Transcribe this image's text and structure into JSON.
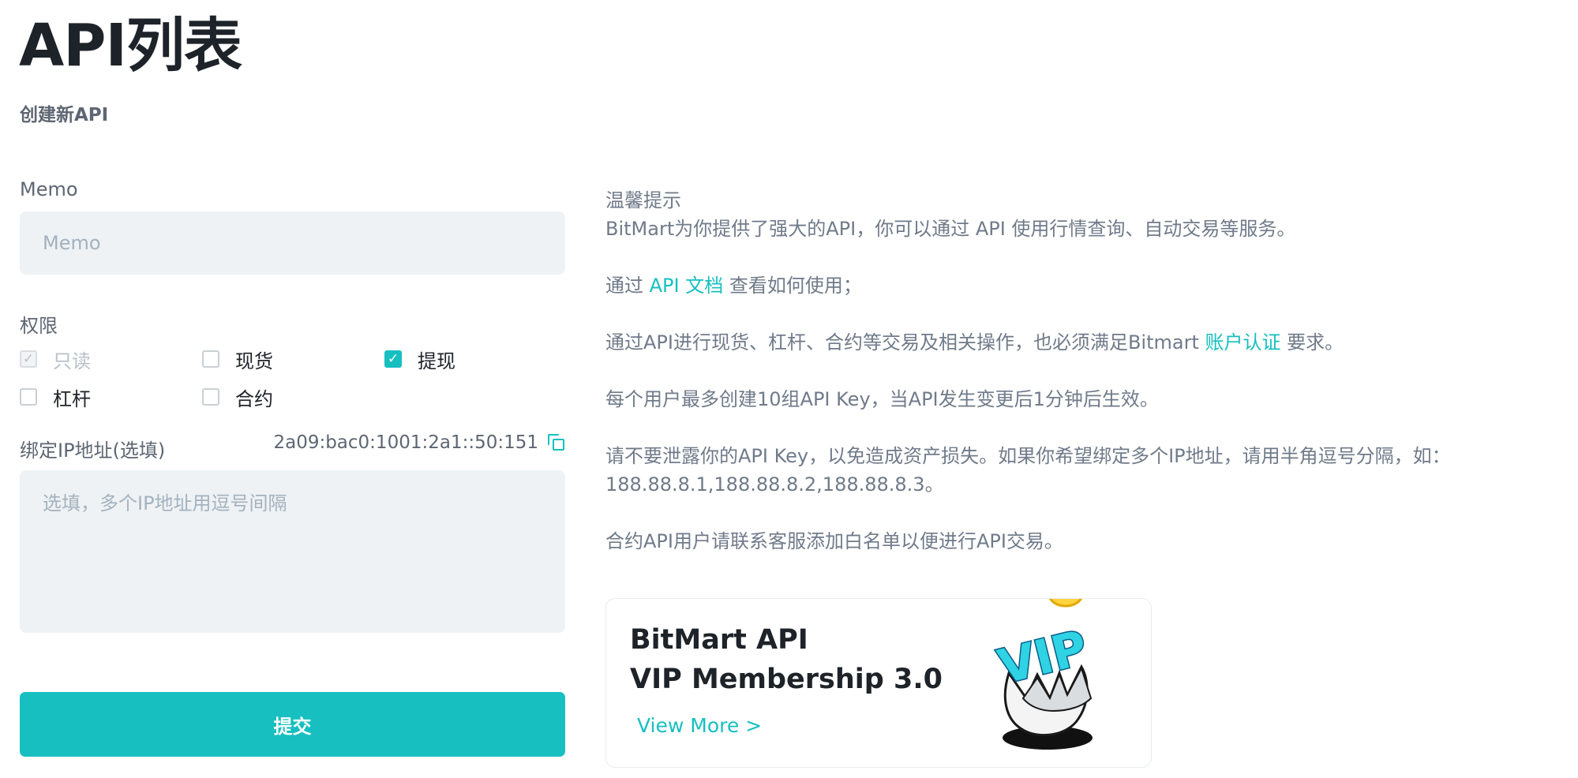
{
  "page": {
    "title": "API列表",
    "subtitle": "创建新API"
  },
  "form": {
    "memo_label": "Memo",
    "memo_placeholder": "Memo",
    "permissions_label": "权限",
    "permissions": [
      {
        "label": "只读",
        "checked": true,
        "disabled": true
      },
      {
        "label": "现货",
        "checked": false,
        "disabled": false
      },
      {
        "label": "提现",
        "checked": true,
        "disabled": false
      },
      {
        "label": "杠杆",
        "checked": false,
        "disabled": false
      },
      {
        "label": "合约",
        "checked": false,
        "disabled": false
      }
    ],
    "ip_label": "绑定IP地址(选填)",
    "current_ip": "2a09:bac0:1001:2a1::50:151",
    "ip_placeholder": "选填，多个IP地址用逗号间隔",
    "submit_label": "提交"
  },
  "tips": {
    "title": "温馨提示",
    "line1": "BitMart为你提供了强大的API，你可以通过 API 使用行情查询、自动交易等服务。",
    "line2_prefix": "通过 ",
    "line2_link": "API 文档",
    "line2_suffix": " 查看如何使用；",
    "line3_prefix": "通过API进行现货、杠杆、合约等交易及相关操作，也必须满足Bitmart ",
    "line3_link": "账户认证",
    "line3_suffix": " 要求。",
    "line4": "每个用户最多创建10组API Key，当API发生变更后1分钟后生效。",
    "line5a": "请不要泄露你的API Key，以免造成资产损失。如果你希望绑定多个IP地址，请用半角逗号分隔，如：",
    "line5b": "188.88.8.1,188.88.8.2,188.88.8.3。",
    "line6": "合约API用户请联系客服添加白名单以便进行API交易。"
  },
  "vip_card": {
    "title_line1": "BitMart API",
    "title_line2": "VIP Membership 3.0",
    "view_more": "View More >",
    "badge_text": "VIP"
  },
  "colors": {
    "accent": "#17bfc1",
    "input_bg": "#eef2f5",
    "text_primary": "#1e2329",
    "text_secondary": "#707a8a"
  }
}
